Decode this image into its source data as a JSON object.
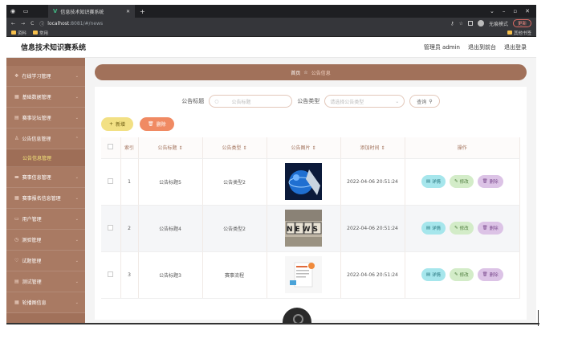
{
  "browser": {
    "tab_title": "信息技术知识赛系统",
    "url_host": "localhost",
    "url_path": ":8081/#/news",
    "update_label": "更新",
    "incognito_label": "无痕模式",
    "bookmarks": [
      "资料",
      "常用"
    ],
    "bookmarks_right": "其他书签"
  },
  "app": {
    "title": "信息技术知识赛系统",
    "user_label": "管理员 admin",
    "back_label": "退出到前台",
    "logout_label": "退出登录"
  },
  "sidebar": {
    "items": [
      {
        "label": "在线学习管理"
      },
      {
        "label": "基础数据管理"
      },
      {
        "label": "赛事论坛管理"
      },
      {
        "label": "公告信息管理"
      },
      {
        "label": "赛事信息管理"
      },
      {
        "label": "赛事报名信息管理"
      },
      {
        "label": "用户管理"
      },
      {
        "label": "测验管理"
      },
      {
        "label": "试题管理"
      },
      {
        "label": "测试管理"
      },
      {
        "label": "轮播图信息"
      }
    ],
    "submenu_label": "公告信息管理"
  },
  "breadcrumb": {
    "home": "首页",
    "current": "公告信息"
  },
  "search": {
    "title_label": "公告标题",
    "title_placeholder": "公告标题",
    "type_label": "公告类型",
    "type_placeholder": "请选择公告类型",
    "query_label": "查询"
  },
  "actions": {
    "add_label": "新增",
    "delete_label": "删除"
  },
  "table": {
    "headers": [
      "索引",
      "公告标题",
      "公告类型",
      "公告图片",
      "添加时间",
      "操作"
    ],
    "rows": [
      {
        "index": "1",
        "title": "公告标题5",
        "type": "公告类型2",
        "time": "2022-04-06 20:51:24",
        "thumb": "globe"
      },
      {
        "index": "2",
        "title": "公告标题4",
        "type": "公告类型2",
        "time": "2022-04-06 20:51:24",
        "thumb": "news"
      },
      {
        "index": "3",
        "title": "公告标题3",
        "type": "赛事流程",
        "time": "2022-04-06 20:51:24",
        "thumb": "doc"
      }
    ],
    "op_view": "详情",
    "op_edit": "修改",
    "op_delete": "删除",
    "news_text": "NEWS"
  },
  "colors": {
    "sidebar": "#a1715a",
    "add_button": "#f2e084",
    "delete_button": "#f08a63",
    "view_button": "#a6e6ec",
    "edit_button": "#d3ecc8",
    "row_delete_button": "#dcc3e6"
  }
}
